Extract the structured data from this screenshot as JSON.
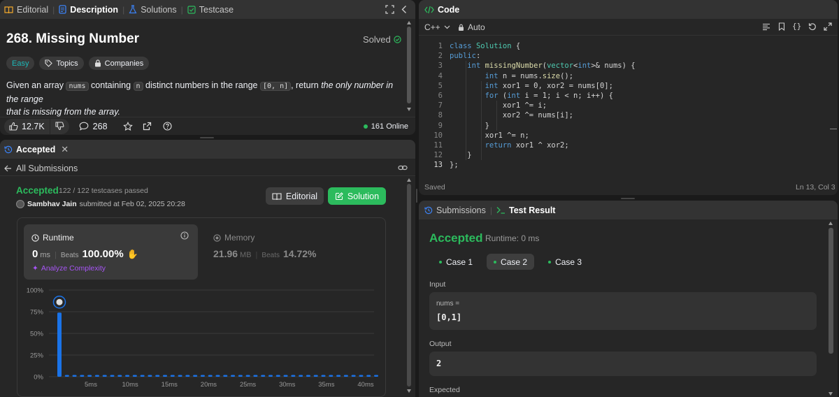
{
  "left_tabs": {
    "editorial": "Editorial",
    "description": "Description",
    "solutions": "Solutions",
    "testcase": "Testcase"
  },
  "problem": {
    "title": "268. Missing Number",
    "status": "Solved",
    "difficulty": "Easy",
    "topics": "Topics",
    "companies": "Companies",
    "desc_1": "Given an array ",
    "desc_code1": "nums",
    "desc_2": " containing ",
    "desc_code2": "n",
    "desc_3": " distinct numbers in the range ",
    "desc_code3": "[0, n]",
    "desc_4": ", return ",
    "desc_em1": "the only number in the range",
    "desc_em2": "that is missing from the array.",
    "likes": "12.7K",
    "comments": "268",
    "online": "161 Online"
  },
  "submission": {
    "tab_label": "Accepted",
    "all_submissions": "All Submissions",
    "status": "Accepted",
    "testcases": "122 / 122 testcases passed",
    "user": "Sambhav Jain",
    "submitted_text": "submitted at Feb 02, 2025 20:28",
    "editorial_btn": "Editorial",
    "solution_btn": "Solution",
    "runtime_label": "Runtime",
    "runtime_value": "0",
    "runtime_unit": "ms",
    "beats_label": "Beats",
    "runtime_beats": "100.00%",
    "analyze": "Analyze Complexity",
    "memory_label": "Memory",
    "memory_value": "21.96",
    "memory_unit": "MB",
    "memory_beats": "14.72%"
  },
  "chart_data": {
    "type": "bar",
    "y_ticks": [
      "100%",
      "75%",
      "50%",
      "25%",
      "0%"
    ],
    "x_ticks": [
      "5ms",
      "10ms",
      "15ms",
      "20ms",
      "25ms",
      "30ms",
      "35ms",
      "40ms"
    ],
    "ylim": [
      0,
      100
    ],
    "bars": [
      74,
      2,
      2,
      2,
      2,
      2,
      2,
      2,
      2,
      2,
      2,
      2,
      2,
      2,
      2,
      2,
      2,
      2,
      2,
      2,
      2,
      2,
      2,
      2,
      2,
      2,
      2,
      2,
      2,
      2,
      2,
      2,
      2,
      2,
      2,
      2,
      2,
      2,
      2,
      2,
      2,
      2,
      2
    ],
    "highlight_index": 0,
    "bar_color": "#1a73e8"
  },
  "code": {
    "title": "Code",
    "language": "C++",
    "mode": "Auto",
    "status": "Saved",
    "cursor": "Ln 13, Col 3",
    "lines": [
      [
        [
          "kw",
          "class "
        ],
        [
          "ty",
          "Solution"
        ],
        [
          "tx",
          " {"
        ]
      ],
      [
        [
          "kw",
          "public"
        ],
        [
          "tx",
          ":"
        ]
      ],
      [
        [
          "tx",
          "    "
        ],
        [
          "kw",
          "int "
        ],
        [
          "fn",
          "missingNumber"
        ],
        [
          "tx",
          "("
        ],
        [
          "ty",
          "vector"
        ],
        [
          "tx",
          "<"
        ],
        [
          "kw",
          "int"
        ],
        [
          "tx",
          ">& "
        ],
        [
          "tx",
          "nums) {"
        ]
      ],
      [
        [
          "tx",
          "        "
        ],
        [
          "kw",
          "int "
        ],
        [
          "tx",
          "n = nums."
        ],
        [
          "fn",
          "size"
        ],
        [
          "tx",
          "();"
        ]
      ],
      [
        [
          "tx",
          "        "
        ],
        [
          "kw",
          "int "
        ],
        [
          "tx",
          "xor1 = 0, xor2 = nums[0];"
        ]
      ],
      [
        [
          "tx",
          "        "
        ],
        [
          "kw",
          "for "
        ],
        [
          "tx",
          "("
        ],
        [
          "kw",
          "int "
        ],
        [
          "tx",
          "i = 1; i < n; i++) {"
        ]
      ],
      [
        [
          "tx",
          "            xor1 ^= i;"
        ]
      ],
      [
        [
          "tx",
          "            xor2 ^= nums[i];"
        ]
      ],
      [
        [
          "tx",
          "        }"
        ]
      ],
      [
        [
          "tx",
          "        xor1 ^= n;"
        ]
      ],
      [
        [
          "tx",
          "        "
        ],
        [
          "kw",
          "return "
        ],
        [
          "tx",
          "xor1 ^ xor2;"
        ]
      ],
      [
        [
          "tx",
          "    }"
        ]
      ],
      [
        [
          "tx",
          "};"
        ]
      ]
    ]
  },
  "result": {
    "submissions_tab": "Submissions",
    "test_result_tab": "Test Result",
    "status": "Accepted",
    "runtime": "Runtime: 0 ms",
    "cases": [
      "Case 1",
      "Case 2",
      "Case 3"
    ],
    "input_label": "Input",
    "input_var": "nums =",
    "input_value": "[0,1]",
    "output_label": "Output",
    "output_value": "2",
    "expected_label": "Expected"
  },
  "colors": {
    "accent_green": "#2cbb5d",
    "easy": "#1cb8b8",
    "code_icon": "#2cbb5d"
  }
}
